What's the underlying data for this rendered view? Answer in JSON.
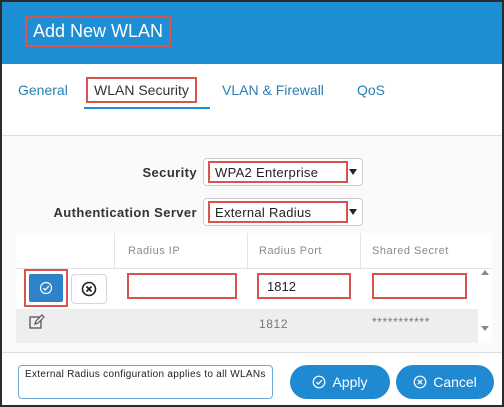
{
  "dialog": {
    "title": "Add New WLAN"
  },
  "tabs": [
    {
      "label": "General"
    },
    {
      "label": "WLAN Security"
    },
    {
      "label": "VLAN & Firewall"
    },
    {
      "label": "QoS"
    }
  ],
  "form": {
    "security_label": "Security",
    "security_value": "WPA2 Enterprise",
    "auth_label": "Authentication Server",
    "auth_value": "External Radius"
  },
  "table": {
    "headers": {
      "ip": "Radius IP",
      "port": "Radius Port",
      "secret": "Shared Secret"
    },
    "edit_row": {
      "ip": "",
      "port": "1812",
      "secret": ""
    },
    "rows": [
      {
        "ip": "",
        "port": "1812",
        "secret": "***********"
      }
    ]
  },
  "footer": {
    "note": "External Radius configuration applies to all WLANs",
    "apply_label": "Apply",
    "cancel_label": "Cancel"
  },
  "colors": {
    "header_bg": "#1e8fd5",
    "accent": "#1f8ad1",
    "highlight_outline": "#d9534f"
  },
  "icons": {
    "save": "check-circle-icon",
    "discard": "x-circle-icon",
    "edit": "pencil-edit-icon",
    "apply": "check-circle-icon",
    "cancel": "x-circle-icon"
  }
}
